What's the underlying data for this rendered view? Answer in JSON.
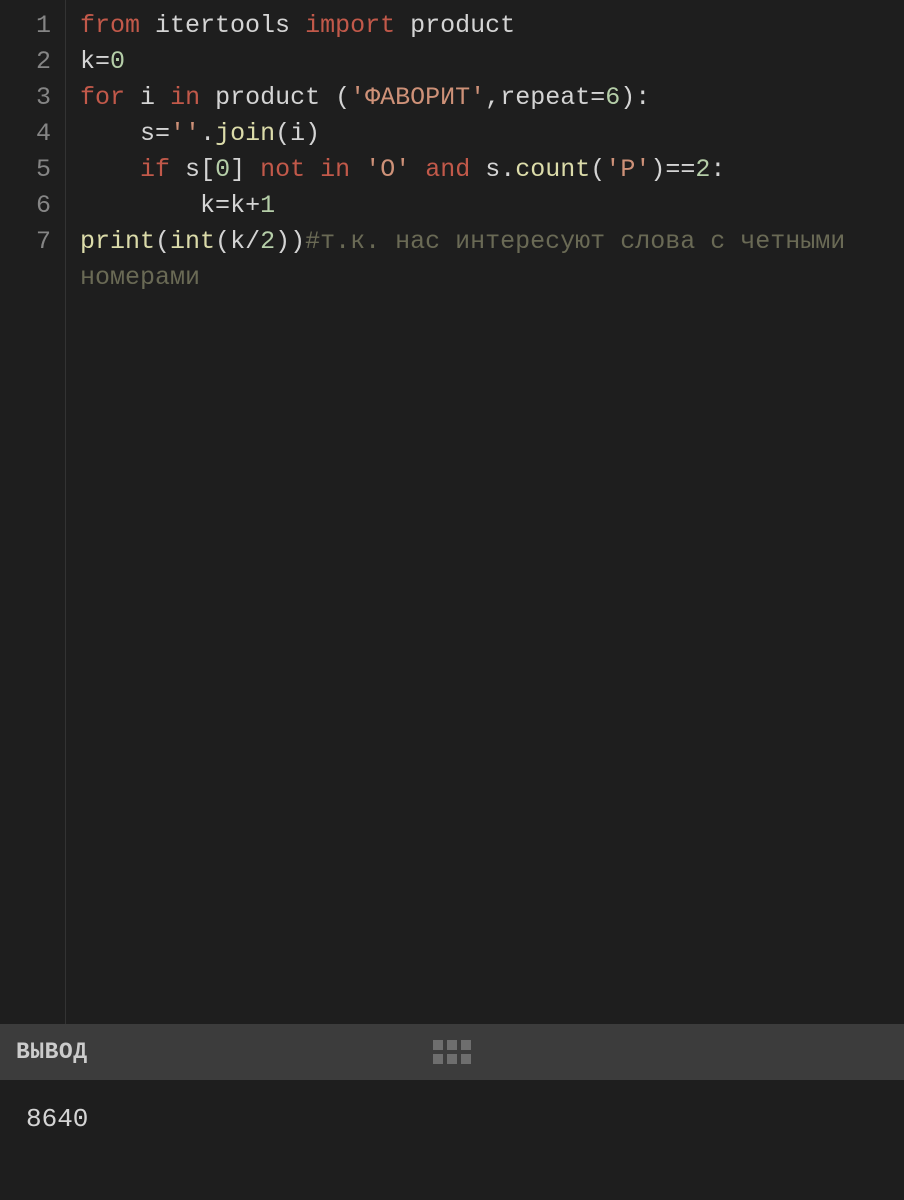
{
  "code": {
    "lines": [
      "1",
      "2",
      "3",
      "4",
      "5",
      "6",
      "7"
    ],
    "line1": {
      "from": "from",
      "itertools": "itertools",
      "import": "import",
      "product": "product"
    },
    "line2": {
      "k": "k",
      "eq": "=",
      "zero": "0"
    },
    "line3": {
      "for": "for",
      "i": "i",
      "in": "in",
      "product": "product",
      "lparen": " (",
      "str": "'ФАВОРИТ'",
      "comma": ",",
      "repeat": "repeat",
      "eq": "=",
      "six": "6",
      "rparen": "):"
    },
    "line4": {
      "indent": "    ",
      "s": "s",
      "eq": "=",
      "empty": "''",
      "dot": ".",
      "join": "join",
      "lparen": "(",
      "i": "i",
      "rparen": ")"
    },
    "line5": {
      "indent": "    ",
      "if": "if",
      "s": "s",
      "lb": "[",
      "zero": "0",
      "rb": "]",
      "not": "not",
      "in": "in",
      "strO": "'О'",
      "and": "and",
      "s2": "s",
      "dot": ".",
      "count": "count",
      "lparen": "(",
      "strR": "'Р'",
      "rparen": ")",
      "eqeq": "==",
      "two": "2",
      "colon": ":"
    },
    "line6": {
      "indent": "        ",
      "k": "k",
      "eq": "=",
      "k2": "k",
      "plus": "+",
      "one": "1"
    },
    "line7": {
      "print": "print",
      "lparen": "(",
      "int": "int",
      "lparen2": "(",
      "k": "k",
      "slash": "/",
      "two": "2",
      "rparen2": ")",
      "rparen": ")",
      "comment": "#т.к. нас интересуют слова с четными номерами"
    }
  },
  "output": {
    "title": "ВЫВОД",
    "value": "8640"
  }
}
